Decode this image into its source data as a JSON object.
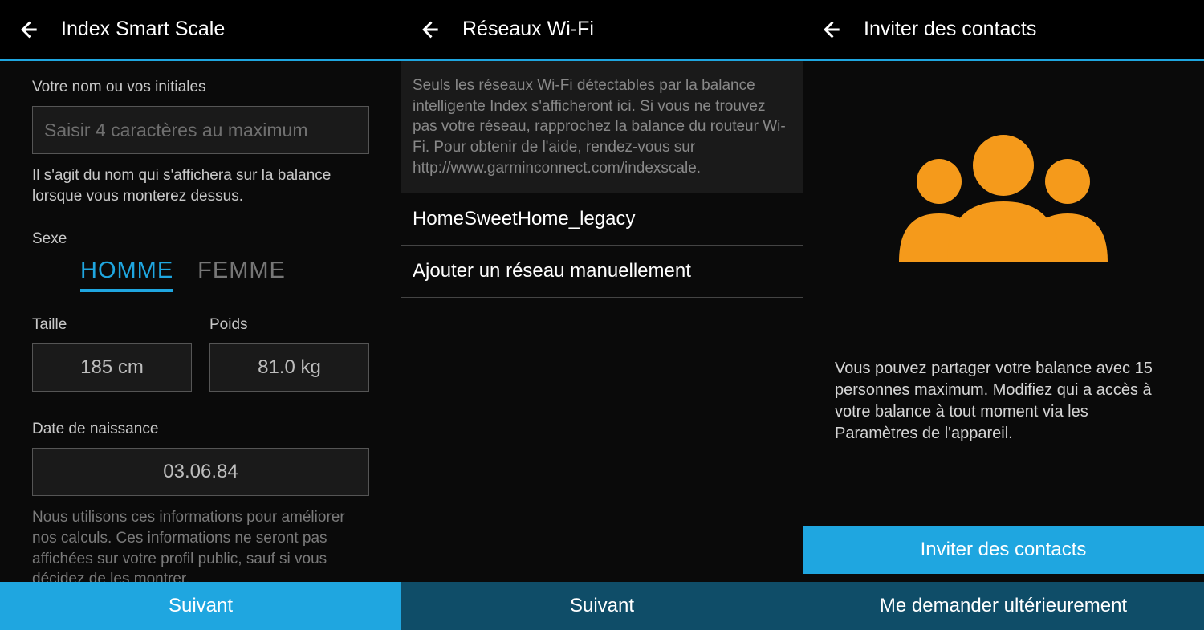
{
  "screen1": {
    "title": "Index Smart Scale",
    "name_label": "Votre nom ou vos initiales",
    "name_placeholder": "Saisir 4 caractères au maximum",
    "name_hint": "Il s'agit du nom qui s'affichera sur la balance lorsque vous monterez dessus.",
    "sex_label": "Sexe",
    "sex_male": "HOMME",
    "sex_female": "FEMME",
    "height_label": "Taille",
    "height_value": "185 cm",
    "weight_label": "Poids",
    "weight_value": "81.0 kg",
    "dob_label": "Date de naissance",
    "dob_value": "03.06.84",
    "disclaimer": "Nous utilisons ces informations pour améliorer nos calculs. Ces informations ne seront pas affichées sur votre profil public, sauf si vous décidez de les montrer.",
    "next": "Suivant"
  },
  "screen2": {
    "title": "Réseaux Wi-Fi",
    "info": "Seuls les réseaux Wi-Fi détectables par la balance intelligente Index s'afficheront ici. Si vous ne trouvez pas votre réseau, rapprochez la balance du routeur Wi-Fi. Pour obtenir de l'aide, rendez-vous sur http://www.garminconnect.com/indexscale.",
    "network": "HomeSweetHome_legacy",
    "add_manual": "Ajouter un réseau manuellement",
    "next": "Suivant"
  },
  "screen3": {
    "title": "Inviter des contacts",
    "desc": "Vous pouvez partager votre balance avec 15 personnes maximum. Modifiez qui a accès à votre balance à tout moment via les Paramètres de l'appareil.",
    "invite": "Inviter des contacts",
    "later": "Me demander ultérieurement"
  }
}
